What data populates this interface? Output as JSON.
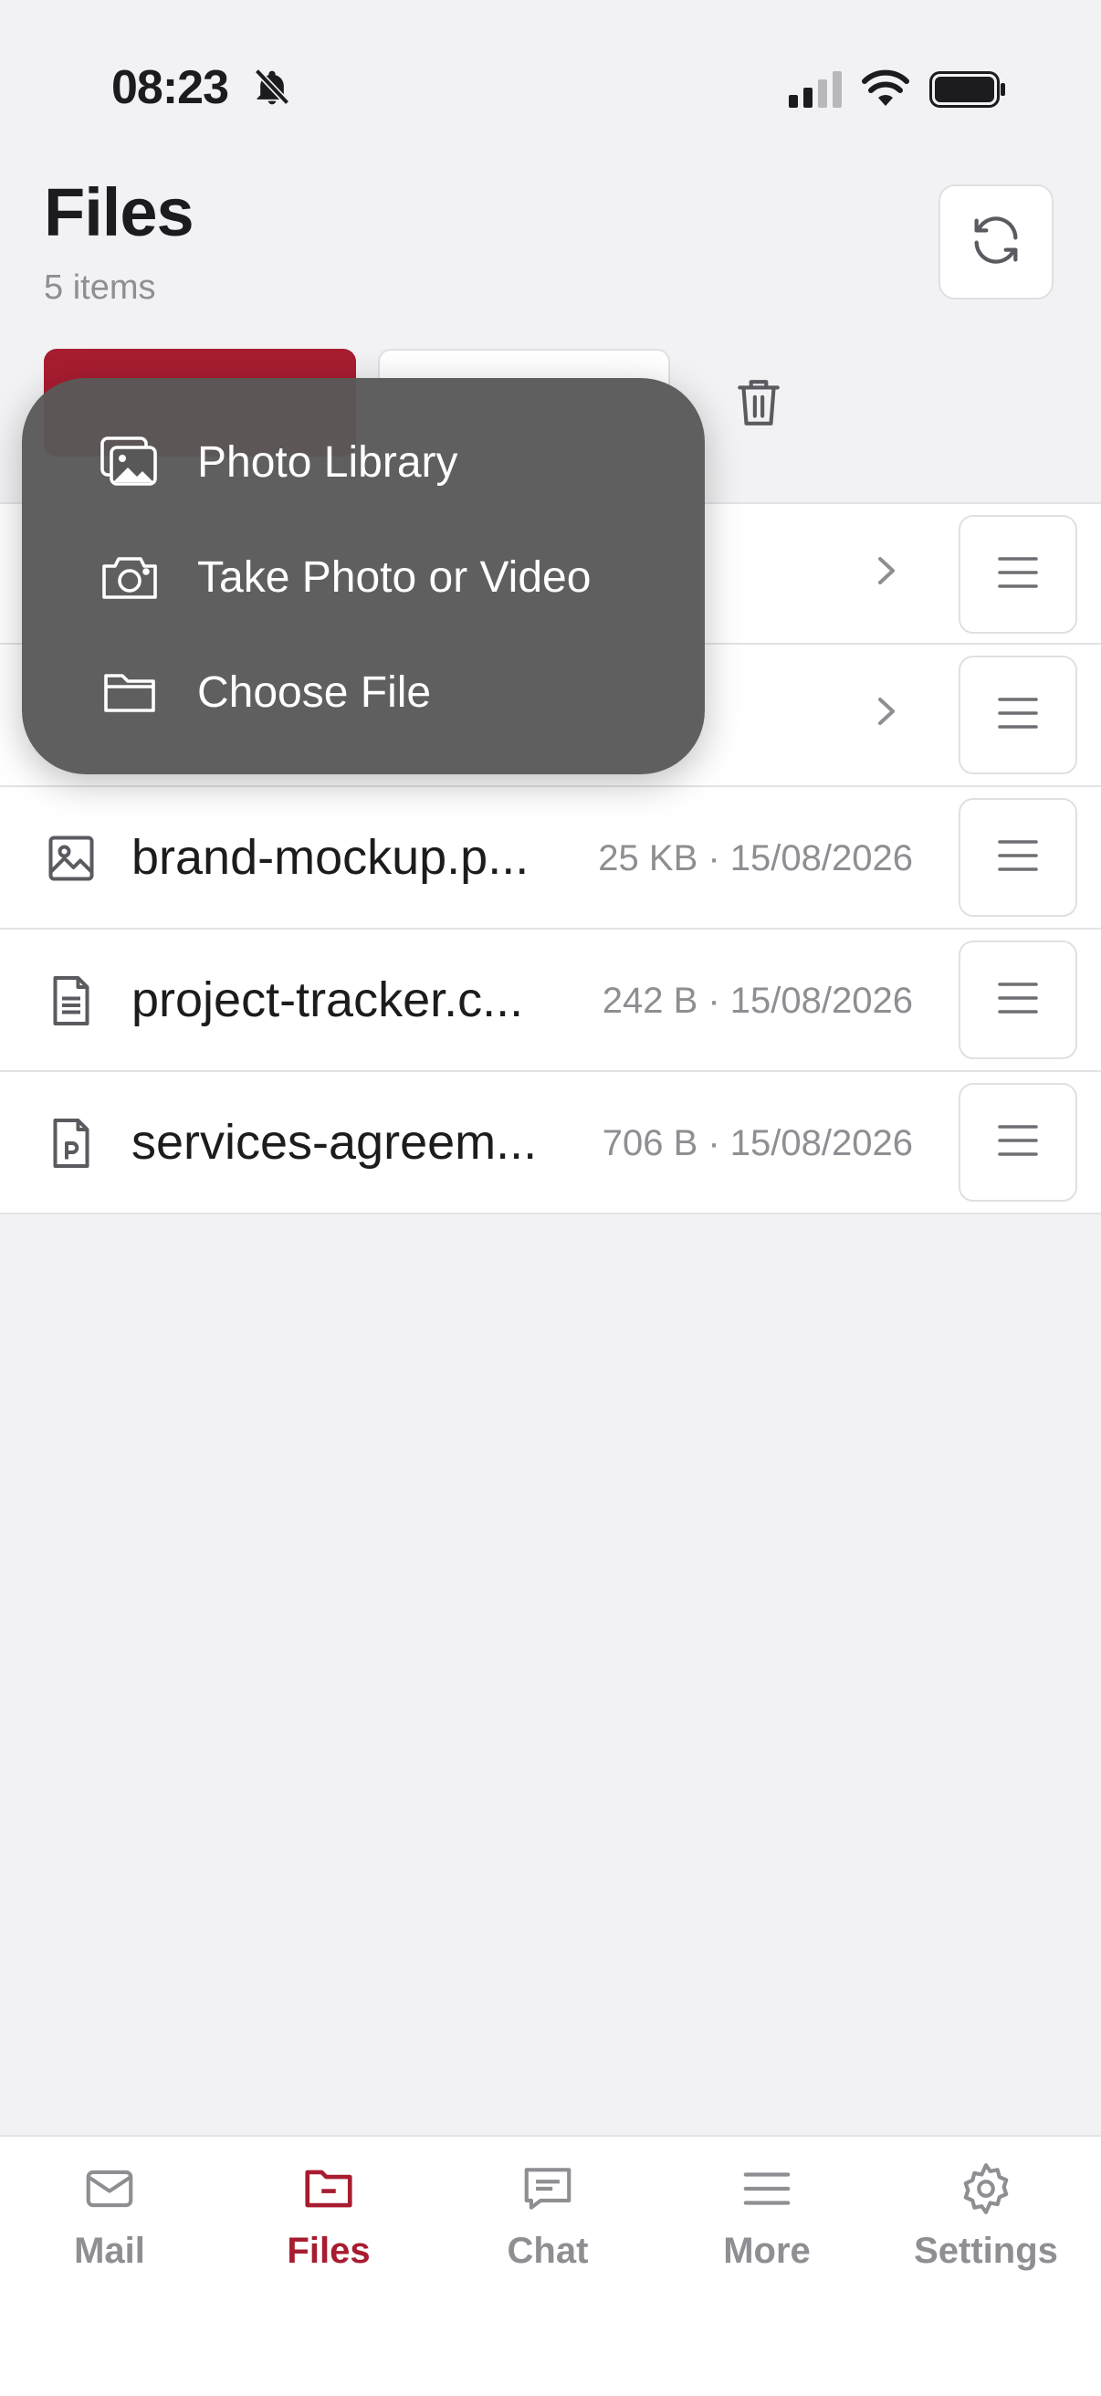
{
  "status_bar": {
    "time": "08:23"
  },
  "header": {
    "title": "Files",
    "item_count": "5 items"
  },
  "popup_menu": {
    "items": [
      {
        "label": "Photo Library",
        "icon": "photo-library-icon"
      },
      {
        "label": "Take Photo or Video",
        "icon": "camera-icon"
      },
      {
        "label": "Choose File",
        "icon": "folder-icon"
      }
    ]
  },
  "files": [
    {
      "name": "",
      "meta": "",
      "icon": "folder-icon"
    },
    {
      "name": "",
      "meta": "",
      "icon": "folder-icon"
    },
    {
      "name": "brand-mockup.p...",
      "meta": "25 KB · 15/08/2026",
      "icon": "image-file-icon"
    },
    {
      "name": "project-tracker.c...",
      "meta": "242 B · 15/08/2026",
      "icon": "document-icon"
    },
    {
      "name": "services-agreem...",
      "meta": "706 B · 15/08/2026",
      "icon": "pdf-file-icon"
    }
  ],
  "tab_bar": {
    "tabs": [
      {
        "label": "Mail",
        "icon": "mail-icon"
      },
      {
        "label": "Files",
        "icon": "folder-icon",
        "active": true
      },
      {
        "label": "Chat",
        "icon": "chat-icon"
      },
      {
        "label": "More",
        "icon": "menu-icon"
      },
      {
        "label": "Settings",
        "icon": "gear-icon"
      }
    ]
  },
  "colors": {
    "accent": "#a81c30",
    "muted": "#8e8e93",
    "background": "#f2f2f4"
  }
}
